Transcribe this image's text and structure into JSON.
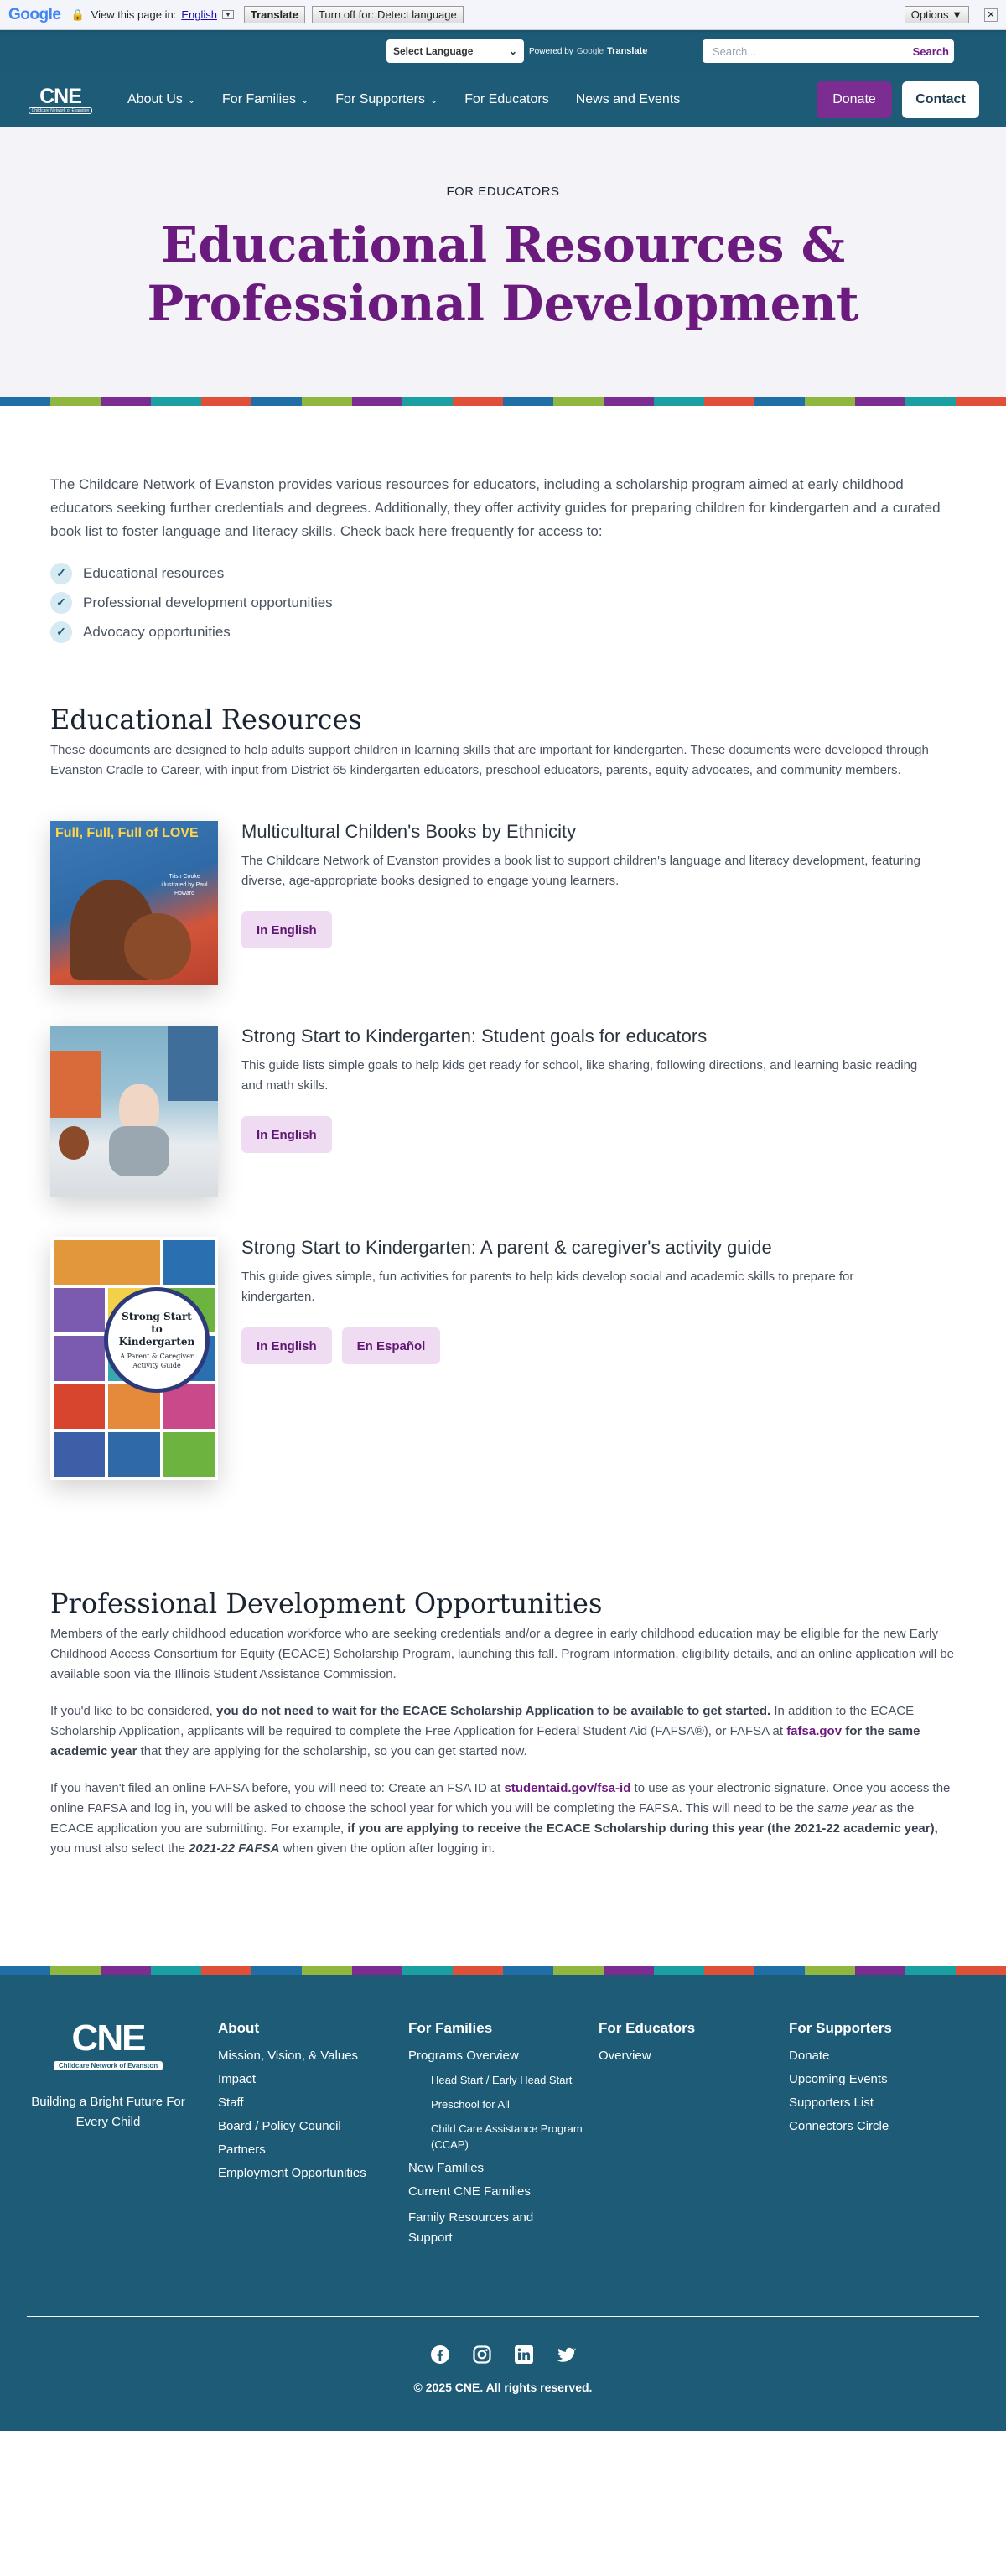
{
  "translate_bar": {
    "logo": "Google",
    "prompt": "View this page in:",
    "language": "English",
    "translate_button": "Translate",
    "turn_off_button": "Turn off for: Detect language",
    "options_button": "Options ▼",
    "close": "✕"
  },
  "utility": {
    "language_select": "Select Language",
    "powered_by": "Powered by",
    "google_word": "Google",
    "translate_word": "Translate",
    "search_placeholder": "Search...",
    "search_button": "Search"
  },
  "nav": {
    "logo_text": "CNE",
    "logo_sub": "Childcare Network of Evanston",
    "items": [
      {
        "label": "About Us",
        "dropdown": true
      },
      {
        "label": "For Families",
        "dropdown": true
      },
      {
        "label": "For Supporters",
        "dropdown": true
      },
      {
        "label": "For Educators",
        "dropdown": false
      },
      {
        "label": "News and Events",
        "dropdown": false
      }
    ],
    "donate": "Donate",
    "contact": "Contact"
  },
  "hero": {
    "eyebrow": "FOR EDUCATORS",
    "title": "Educational Resources & Professional Development"
  },
  "stripe_colors": [
    "#1f6fa6",
    "#8fb63f",
    "#7b2d91",
    "#1aa0a0",
    "#e04f37"
  ],
  "intro": {
    "text": "The Childcare Network of Evanston provides various resources for educators, including a scholarship program aimed at early childhood educators seeking further credentials and degrees. Additionally, they offer activity guides for preparing children for kindergarten and a curated book list to foster language and literacy skills. Check back here frequently for access to:",
    "checklist": [
      "Educational resources",
      "Professional development opportunities",
      "Advocacy opportunities"
    ]
  },
  "educational": {
    "heading": "Educational Resources",
    "lead": "These documents are designed to help adults support children in learning skills that are important for kindergarten. These documents were developed through Evanston Cradle to Career, with input from District 65 kindergarten educators, preschool educators, parents, equity advocates, and community members.",
    "resources": [
      {
        "title": "Multicultural Childen's Books by Ethnicity",
        "description": "The Childcare Network of Evanston provides a book list to support children's language and literacy development, featuring diverse, age-appropriate books designed to engage young learners.",
        "cover_title": "Full, Full, Full of LOVE",
        "cover_author": "Trish Cooke",
        "cover_illustrator": "illustrated by Paul Howard",
        "buttons": [
          "In English"
        ]
      },
      {
        "title": "Strong Start to Kindergarten: Student goals for educators",
        "description": "This guide lists simple goals to help kids get ready for school, like sharing, following directions, and learning basic reading and math skills.",
        "buttons": [
          "In English"
        ]
      },
      {
        "title": "Strong Start to Kindergarten: A parent & caregiver's activity guide",
        "description": "This guide gives simple, fun activities for parents to help kids develop social and academic skills to prepare for kindergarten.",
        "cover_title": "Strong Start to Kindergarten",
        "cover_sub": "A Parent & Caregiver Activity Guide",
        "buttons": [
          "In English",
          "En Español"
        ]
      }
    ]
  },
  "professional": {
    "heading": "Professional Development Opportunities",
    "p1": "Members of the early childhood education workforce who are seeking credentials and/or a degree in early childhood education may be eligible for the new Early Childhood Access Consortium for Equity (ECACE) Scholarship Program, launching this fall. Program information, eligibility details, and an online application will be available soon via the Illinois Student Assistance Commission.",
    "p2_a": "If you'd like to be considered, ",
    "p2_b": "you do not need to wait for the ECACE Scholarship Application to be available to get started.",
    "p2_c": "  In addition to the ECACE Scholarship Application, applicants will be required to complete the Free Application for Federal Student Aid (FAFSA®), or FAFSA at ",
    "p2_link": "fafsa.gov",
    "p2_d": " for the same academic year",
    "p2_e": " that they are applying for the scholarship, so you can get started now.",
    "p3_a": "If you haven't filed an online FAFSA before, you will need to: Create an FSA ID at ",
    "p3_link": "studentaid.gov/fsa-id",
    "p3_b": " to use as your electronic signature. Once you access the online FAFSA and log in, you will be asked to choose the school year for which you will be completing the FAFSA.  This will need to be the ",
    "p3_c": "same year",
    "p3_d": " as the ECACE application you are submitting.  For example, ",
    "p3_e": "if you are applying to receive the ECACE Scholarship during this year (the 2021-22 academic year),",
    "p3_f": " you must also select the ",
    "p3_g": "2021-22 FAFSA",
    "p3_h": " when given the option after logging in."
  },
  "footer": {
    "logo_text": "CNE",
    "logo_sub": "Childcare Network of Evanston",
    "tagline": "Building a Bright Future For Every Child",
    "about": {
      "heading": "About",
      "links": [
        "Mission, Vision, & Values",
        "Impact",
        "Staff",
        "Board / Policy Council",
        "Partners",
        "Employment Opportunities"
      ]
    },
    "families": {
      "heading": "For Families",
      "program": "Programs Overview",
      "sub": [
        "Head Start / Early Head Start",
        "Preschool for All",
        "Child Care Assistance Program (CCAP)"
      ],
      "links": [
        "New Families",
        "Current CNE Families",
        "Family Resources and Support"
      ]
    },
    "educators": {
      "heading": "For Educators",
      "links": [
        "Overview"
      ]
    },
    "supporters": {
      "heading": "For Supporters",
      "links": [
        "Donate",
        "Upcoming Events",
        "Supporters List",
        "Connectors Circle"
      ]
    },
    "social": [
      "facebook-icon",
      "instagram-icon",
      "linkedin-icon",
      "twitter-icon"
    ],
    "copyright": "© 2025 CNE. All rights reserved."
  }
}
